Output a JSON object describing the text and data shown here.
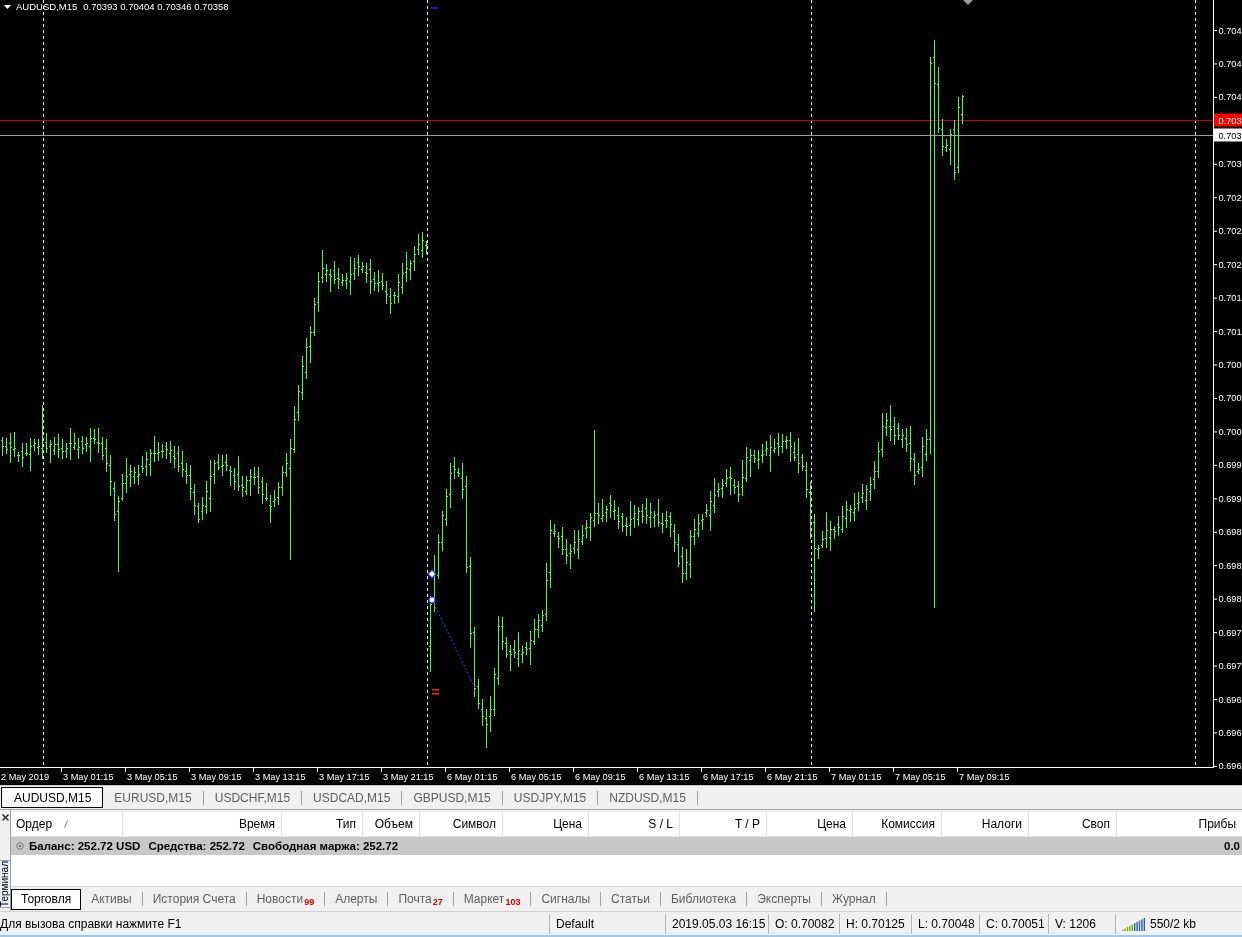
{
  "chart": {
    "header": {
      "symbol": "AUDUSD,M15",
      "quotes": "0.70393 0.70404 0.70346 0.70358"
    },
    "price_axis": [
      "0.704",
      "0.704",
      "0.704",
      "0.703",
      "0.702",
      "0.702",
      "0.702",
      "0.701",
      "0.701",
      "0.700",
      "0.700",
      "0.700",
      "0.699",
      "0.699",
      "0.698",
      "0.698",
      "0.698",
      "0.697",
      "0.697",
      "0.696",
      "0.696",
      "0.696"
    ],
    "price_tags": [
      {
        "kind": "ask",
        "label": "0.703"
      },
      {
        "kind": "bid",
        "label": "0.703"
      }
    ],
    "time_axis": [
      "2 May 2019",
      "3 May 01:15",
      "3 May 05:15",
      "3 May 09:15",
      "3 May 13:15",
      "3 May 17:15",
      "3 May 21:15",
      "6 May 01:15",
      "6 May 05:15",
      "6 May 09:15",
      "6 May 13:15",
      "6 May 17:15",
      "6 May 21:15",
      "7 May 01:15",
      "7 May 05:15",
      "7 May 09:15"
    ]
  },
  "symbol_tabs": [
    {
      "label": "AUDUSD,M15",
      "selected": true
    },
    {
      "label": "EURUSD,M15",
      "selected": false
    },
    {
      "label": "USDCHF,M15",
      "selected": false
    },
    {
      "label": "USDCAD,M15",
      "selected": false
    },
    {
      "label": "GBPUSD,M15",
      "selected": false
    },
    {
      "label": "USDJPY,M15",
      "selected": false
    },
    {
      "label": "NZDUSD,M15",
      "selected": false
    }
  ],
  "terminal": {
    "title": "Терминал",
    "columns": [
      {
        "label": "Ордер",
        "sorted": true
      },
      {
        "label": "Время",
        "sorted": false
      },
      {
        "label": "Тип",
        "sorted": false
      },
      {
        "label": "Объем",
        "sorted": false
      },
      {
        "label": "Символ",
        "sorted": false
      },
      {
        "label": "Цена",
        "sorted": false
      },
      {
        "label": "S / L",
        "sorted": false
      },
      {
        "label": "T / P",
        "sorted": false
      },
      {
        "label": "Цена",
        "sorted": false
      },
      {
        "label": "Комиссия",
        "sorted": false
      },
      {
        "label": "Налоги",
        "sorted": false
      },
      {
        "label": "Своп",
        "sorted": false
      },
      {
        "label": "Прибы",
        "sorted": false
      }
    ],
    "balance": {
      "items": [
        "Баланс: 252.72 USD",
        "Средства: 252.72",
        "Свободная маржа: 252.72"
      ],
      "profit": "0.0"
    },
    "tabs": [
      {
        "label": "Торговля",
        "selected": true
      },
      {
        "label": "Активы",
        "selected": false
      },
      {
        "label": "История Счета",
        "selected": false
      },
      {
        "label": "Новости",
        "badge": "99",
        "selected": false
      },
      {
        "label": "Алерты",
        "selected": false
      },
      {
        "label": "Почта",
        "badge": "27",
        "selected": false
      },
      {
        "label": "Маркет",
        "badge": "103",
        "selected": false
      },
      {
        "label": "Сигналы",
        "selected": false
      },
      {
        "label": "Статьи",
        "selected": false
      },
      {
        "label": "Библиотека",
        "selected": false
      },
      {
        "label": "Эксперты",
        "selected": false
      },
      {
        "label": "Журнал",
        "selected": false
      }
    ]
  },
  "status_bar": {
    "help": "Для вызова справки нажмите F1",
    "profile": "Default",
    "time": "2019.05.03 16:15",
    "open": "O: 0.70082",
    "high": "H: 0.70125",
    "low": "L: 0.70048",
    "close": "C: 0.70051",
    "volume": "V: 1206",
    "traffic": "550/2 kb"
  }
}
